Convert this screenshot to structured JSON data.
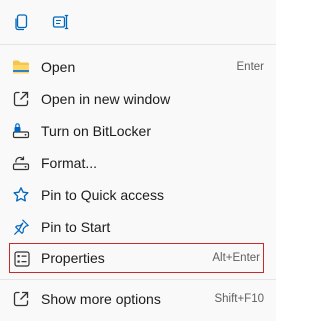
{
  "toolbar": {
    "buttons": [
      {
        "icon": "copy-icon"
      },
      {
        "icon": "rename-icon"
      }
    ]
  },
  "menu": {
    "items": [
      {
        "label": "Open",
        "shortcut": "Enter",
        "icon": "folder-icon"
      },
      {
        "label": "Open in new window",
        "shortcut": "",
        "icon": "open-new-window-icon"
      },
      {
        "label": "Turn on BitLocker",
        "shortcut": "",
        "icon": "bitlocker-icon"
      },
      {
        "label": "Format...",
        "shortcut": "",
        "icon": "format-icon"
      },
      {
        "label": "Pin to Quick access",
        "shortcut": "",
        "icon": "star-icon"
      },
      {
        "label": "Pin to Start",
        "shortcut": "",
        "icon": "pin-icon"
      },
      {
        "label": "Properties",
        "shortcut": "Alt+Enter",
        "icon": "properties-icon",
        "highlighted": true
      },
      {
        "label": "Show more options",
        "shortcut": "Shift+F10",
        "icon": "more-options-icon"
      }
    ]
  },
  "colors": {
    "accent": "#0067c0",
    "highlight_border": "#c42b2b",
    "folder": "#f4c64e"
  }
}
